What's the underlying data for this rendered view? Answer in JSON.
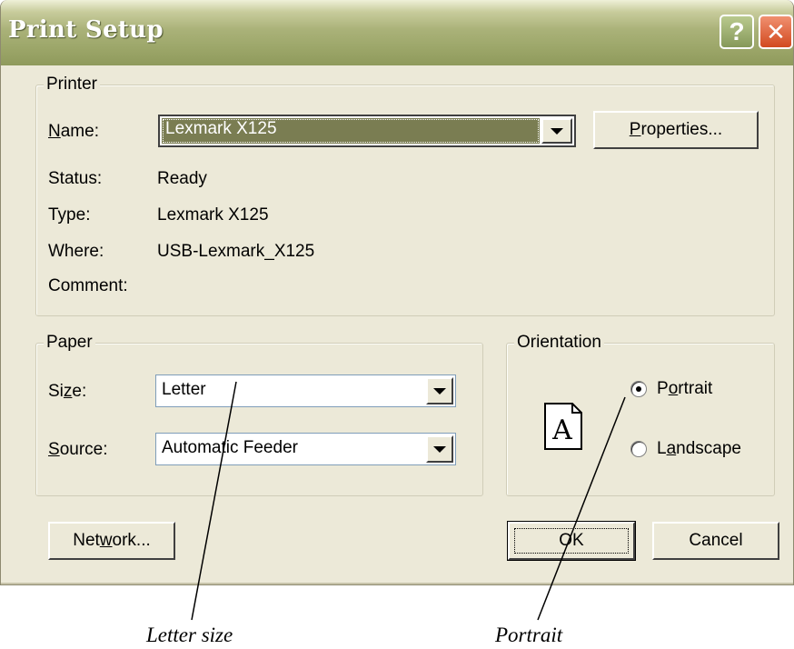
{
  "window": {
    "title": "Print Setup",
    "help_glyph": "?",
    "close_glyph": "✕",
    "icons": [
      "help-icon",
      "close-icon"
    ]
  },
  "printer": {
    "legend": "Printer",
    "name_label_u": "N",
    "name_label_rest": "ame:",
    "name_value": "Lexmark X125",
    "properties_u": "P",
    "properties_rest": "roperties...",
    "status_label": "Status:",
    "status_value": "Ready",
    "type_label": "Type:",
    "type_value": "Lexmark X125",
    "where_label": "Where:",
    "where_value": "USB-Lexmark_X125",
    "comment_label": "Comment:"
  },
  "paper": {
    "legend": "Paper",
    "size_label_pre": "Si",
    "size_label_u": "z",
    "size_label_post": "e:",
    "size_value": "Letter",
    "source_label_u": "S",
    "source_label_rest": "ource:",
    "source_value": "Automatic Feeder"
  },
  "orientation": {
    "legend": "Orientation",
    "page_glyph": "A",
    "portrait_pre": "P",
    "portrait_u": "o",
    "portrait_post": "rtrait",
    "landscape_pre": "L",
    "landscape_u": "a",
    "landscape_post": "ndscape",
    "selected": "Portrait"
  },
  "buttons": {
    "network_pre": "Net",
    "network_u": "w",
    "network_post": "ork...",
    "ok": "OK",
    "cancel": "Cancel"
  },
  "annotations": {
    "letter_size": "Letter size",
    "portrait": "Portrait"
  },
  "colors": {
    "dialog_bg": "#ece9d8",
    "title_bar": "#9ea86b",
    "selection": "#7a7d52",
    "close_button": "#d24a20"
  }
}
